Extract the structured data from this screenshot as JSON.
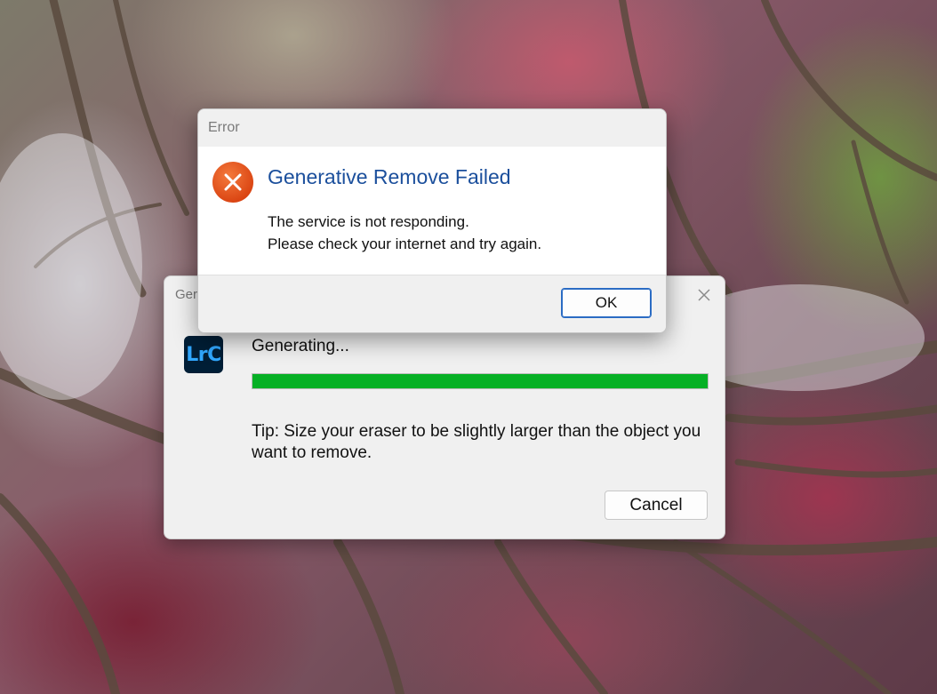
{
  "progress_dialog": {
    "title": "Generative Remove",
    "title_visible": "Ger",
    "app_icon_label": "LrC",
    "app_icon_name": "lightroom-classic-icon",
    "status": "Generating...",
    "progress": 1.0,
    "progress_color": "#06b025",
    "tip": "Tip: Size your eraser to be slightly larger than the object you want to remove.",
    "cancel_label": "Cancel",
    "close_icon": "close-icon"
  },
  "error_dialog": {
    "title": "Error",
    "icon": "error-icon",
    "heading": "Generative Remove Failed",
    "message_line1": "The service is not responding.",
    "message_line2": "Please check your internet and try again.",
    "ok_label": "OK",
    "heading_color": "#1b4f9c",
    "icon_color": "#e0501e"
  }
}
